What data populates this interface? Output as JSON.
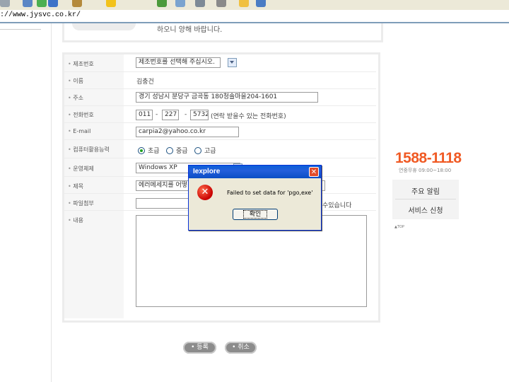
{
  "browser": {
    "address": "://www.jysvc.co.kr/"
  },
  "notice": {
    "text": "하오니 양해 바랍니다."
  },
  "form": {
    "labels": [
      "제조번호",
      "이름",
      "주소",
      "전화번호",
      "E-mail",
      "컴퓨터활용능력",
      "운영체제",
      "제목",
      "파일첨부",
      "내용"
    ],
    "serial_select": "제조번호를 선택해 주십시오.",
    "name": "김충건",
    "address": "경기 성남시 분당구 금곡동 180청솔마을204-1601",
    "phone": {
      "part1": "011",
      "part2": "227",
      "part3": "5732",
      "dash": "-",
      "hint": "(연락 받을수 있는 전화번호)"
    },
    "email": "carpia2@yahoo.co.kr",
    "skill": {
      "options": [
        "초급",
        "중급",
        "고급"
      ],
      "selected": "초급"
    },
    "os": "Windows XP",
    "subject": "에러메세지를 어떻",
    "file_hint_tail": "수있습니다",
    "submit_label": "• 등록",
    "cancel_label": "• 취소"
  },
  "sidebar": {
    "phone": "1588-1118",
    "hours": "연중무휴 09:00~18:00",
    "notice_link": "주요 알림",
    "service_link": "서비스 신청",
    "top_link": "▲TOP"
  },
  "dialog": {
    "title": "Iexplore",
    "message": "Failed to set data for 'pgo,exe'",
    "ok_label": "확인",
    "close_glyph": "✕"
  },
  "colors": {
    "accent": "#f05a24",
    "dialog_title": "#245edb",
    "error": "#c80000"
  }
}
